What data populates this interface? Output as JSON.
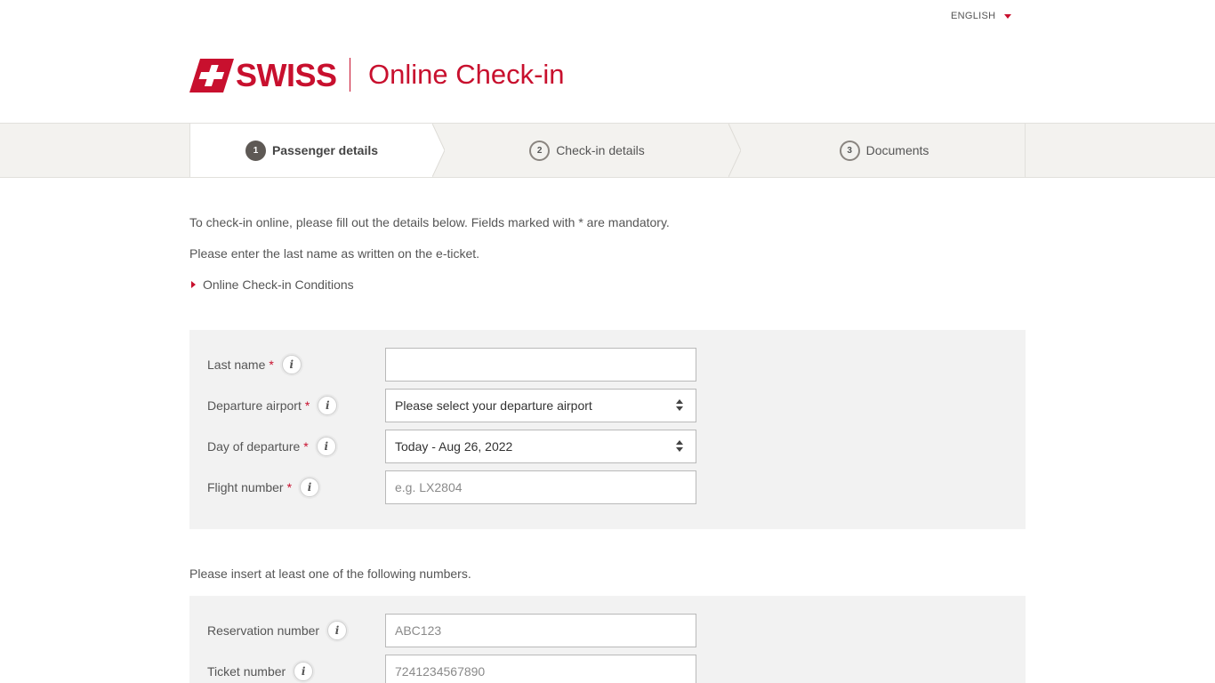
{
  "header": {
    "language": "ENGLISH",
    "brand": "SWISS",
    "app_title": "Online Check-in"
  },
  "steps": [
    {
      "number": "1",
      "label": "Passenger details",
      "active": true
    },
    {
      "number": "2",
      "label": "Check-in details",
      "active": false
    },
    {
      "number": "3",
      "label": "Documents",
      "active": false
    }
  ],
  "intro": {
    "line1": "To check-in online, please fill out the details below. Fields marked with * are mandatory.",
    "line2": "Please enter the last name as written on the e-ticket.",
    "conditions_link": "Online Check-in Conditions"
  },
  "form": {
    "last_name": {
      "label": "Last name",
      "required": "*",
      "value": "",
      "placeholder": ""
    },
    "departure_airport": {
      "label": "Departure airport",
      "required": "*",
      "selected": "Please select your departure airport"
    },
    "day_of_departure": {
      "label": "Day of departure",
      "required": "*",
      "selected": "Today - Aug 26, 2022"
    },
    "flight_number": {
      "label": "Flight number",
      "required": "*",
      "placeholder": "e.g. LX2804"
    }
  },
  "numbers_section": {
    "instruction": "Please insert at least one of the following numbers.",
    "reservation_number": {
      "label": "Reservation number",
      "placeholder": "ABC123"
    },
    "ticket_number": {
      "label": "Ticket number",
      "placeholder": "7241234567890"
    }
  },
  "info_icon_glyph": "i",
  "colors": {
    "brand_red": "#c8102e",
    "step_bar": "#f3f2ef",
    "panel": "#f2f2f2"
  }
}
